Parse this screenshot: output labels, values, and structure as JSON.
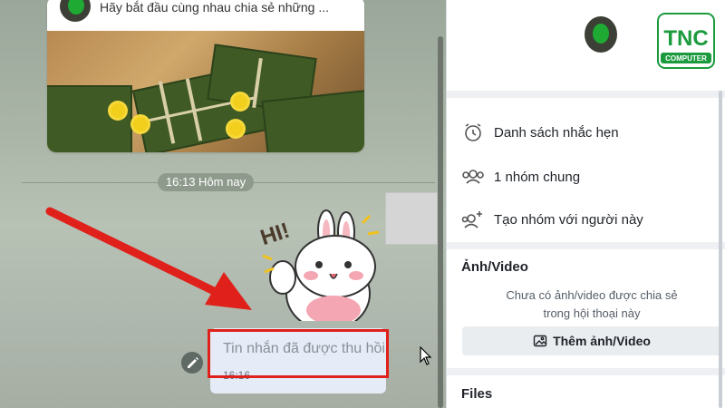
{
  "chat": {
    "card_text": "Hãy bắt đầu cùng nhau chia sẻ những ...",
    "time_divider": "16:13 Hôm nay",
    "sticker_text": "HI!",
    "recalled_message": "Tin nhắn đã được thu hồi",
    "recalled_time": "16:16"
  },
  "panel": {
    "logo_text": "TNC",
    "logo_sub": "COMPUTER",
    "menu": [
      {
        "label": "Danh sách nhắc hẹn",
        "icon": "alarm-clock-icon"
      },
      {
        "label": "1 nhóm chung",
        "icon": "group-icon"
      },
      {
        "label": "Tạo nhóm với người này",
        "icon": "add-group-icon"
      }
    ],
    "media_title": "Ảnh/Video",
    "media_empty_line1": "Chưa có ảnh/video được chia sẻ",
    "media_empty_line2": "trong hội thoại này",
    "add_media_label": "Thêm ảnh/Video",
    "files_title": "Files"
  },
  "colors": {
    "highlight_red": "#e0211b",
    "recall_bubble": "#e5ecf7",
    "logo_green": "#1b9a3e"
  }
}
